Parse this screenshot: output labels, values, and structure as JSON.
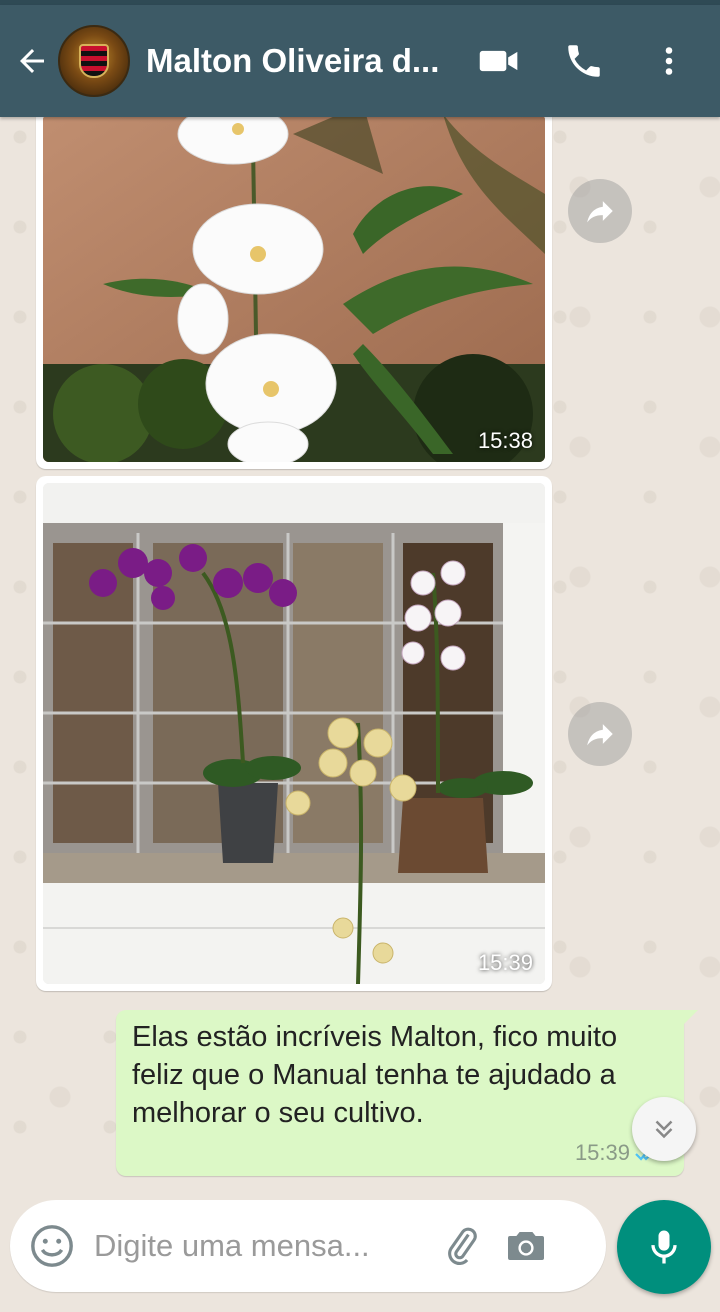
{
  "header": {
    "contact_name": "Malton Oliveira d...",
    "icons": [
      "back-arrow-icon",
      "video-call-icon",
      "voice-call-icon",
      "more-options-icon"
    ]
  },
  "messages": [
    {
      "type": "image",
      "direction": "incoming",
      "time": "15:38",
      "subject": "white-orchid-photo"
    },
    {
      "type": "image",
      "direction": "incoming",
      "time": "15:39",
      "subject": "orchids-on-window-sill-photo"
    },
    {
      "type": "text",
      "direction": "outgoing",
      "text": "Elas estão incríveis Malton, fico muito feliz que o Manual tenha te ajudado a melhorar o seu cultivo.",
      "time": "15:39",
      "status": "read"
    }
  ],
  "composer": {
    "placeholder": "Digite uma mensa..."
  },
  "colors": {
    "appbar": "#3d5a66",
    "chat_bg": "#ece5dd",
    "outgoing_bubble": "#dcf8c6",
    "mic_button": "#008f7d",
    "read_tick": "#4fc3f7"
  }
}
